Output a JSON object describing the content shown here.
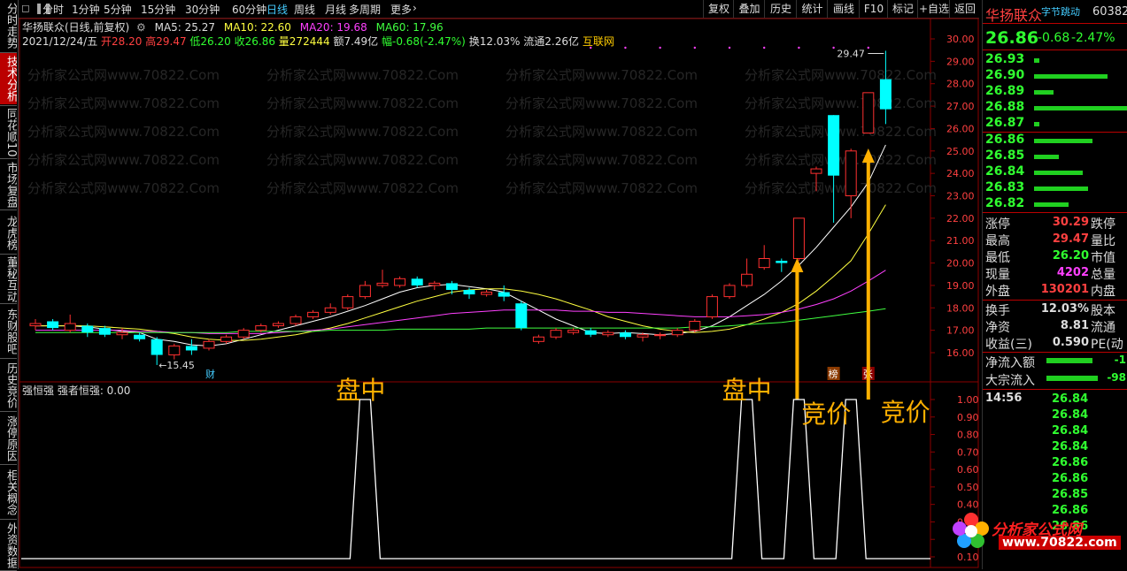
{
  "left_tabs": [
    "分时走势",
    "技术分析",
    "同花顺10",
    "市场复盘",
    "龙虎榜",
    "董秘互动",
    "东财股吧",
    "历史竞价",
    "涨停原因",
    "相关概念",
    "外资数据"
  ],
  "toolbar": {
    "periods": [
      "分时",
      "1分钟",
      "5分钟",
      "15分钟",
      "30分钟",
      "60分钟",
      "日线",
      "周线",
      "月线",
      "多周期",
      "更多"
    ],
    "selected_period": "日线",
    "right_buttons": [
      "复权",
      "叠加",
      "历史",
      "统计",
      "画线",
      "F10",
      "标记",
      "+自选",
      "返回"
    ]
  },
  "main_info": {
    "title": "华扬联众(日线,前复权)",
    "ma5": "MA5: 25.27",
    "ma10": "MA10: 22.60",
    "ma20": "MA20: 19.68",
    "ma60": "MA60: 17.96",
    "date": "2021/12/24/五",
    "open": "开28.20",
    "high": "高29.47",
    "low": "低26.20",
    "close": "收26.86",
    "volume": "量272444",
    "amount": "额7.49亿",
    "change": "幅-0.68(-2.47%)",
    "turnover": "换12.03%",
    "float_cap": "流通2.26亿",
    "source": "互联网"
  },
  "watermark": "分析家公式网www.70822.Com",
  "price_axis": [
    "30.00",
    "29.00",
    "28.00",
    "27.00",
    "26.00",
    "25.00",
    "24.00",
    "23.00",
    "22.00",
    "21.00",
    "20.00",
    "19.00",
    "18.00",
    "17.00",
    "16.00"
  ],
  "high_label": "29.47",
  "low_label": "15.45",
  "badges": {
    "cai": "财",
    "bang": "榜",
    "zhang": "张"
  },
  "sub_panel": {
    "title": "强恒强 强者恒强: 0.00",
    "axis": [
      "1.00",
      "0.90",
      "0.80",
      "0.70",
      "0.60",
      "0.50",
      "0.40",
      "0.30",
      "0.20",
      "0.10"
    ]
  },
  "annotations": {
    "pz1": "盘中",
    "pz2": "盘中",
    "jj1": "竞价",
    "jj2": "竞价"
  },
  "right_panel": {
    "name": "华扬联众",
    "tag": "字节跳动",
    "code": "60382",
    "price": "26.86",
    "change": "-0.68",
    "change_pct": "-2.47%",
    "sells": [
      {
        "price": "26.93",
        "vol": 0.05
      },
      {
        "price": "26.90",
        "vol": 0.75
      },
      {
        "price": "26.89",
        "vol": 0.2
      },
      {
        "price": "26.88",
        "vol": 1.0
      },
      {
        "price": "26.87",
        "vol": 0.05
      }
    ],
    "buys": [
      {
        "price": "26.86",
        "vol": 0.6
      },
      {
        "price": "26.85",
        "vol": 0.25
      },
      {
        "price": "26.84",
        "vol": 0.5
      },
      {
        "price": "26.83",
        "vol": 0.55
      },
      {
        "price": "26.82",
        "vol": 0.35
      }
    ],
    "stats": [
      {
        "label": "涨停",
        "value": "30.29",
        "label2": "跌停",
        "color": "#ff4040"
      },
      {
        "label": "最高",
        "value": "29.47",
        "label2": "量比",
        "color": "#ff4040"
      },
      {
        "label": "最低",
        "value": "26.20",
        "label2": "市值",
        "color": "#30ff30"
      },
      {
        "label": "现量",
        "value": "4202",
        "label2": "总量",
        "color": "#ff40ff"
      },
      {
        "label": "外盘",
        "value": "130201",
        "label2": "内盘",
        "color": "#ff4040"
      }
    ],
    "stats2": [
      {
        "label": "换手",
        "value": "12.03%",
        "label2": "股本"
      },
      {
        "label": "净资",
        "value": "8.81",
        "label2": "流通"
      },
      {
        "label": "收益(三)",
        "value": "0.590",
        "label2": "PE(动"
      }
    ],
    "flows": [
      {
        "label": "净流入额",
        "value": "-1"
      },
      {
        "label": "大宗流入",
        "value": "-98"
      }
    ],
    "ticks_time": "14:56",
    "ticks": [
      "26.84",
      "26.84",
      "26.84",
      "26.84",
      "26.86",
      "26.86",
      "26.85",
      "26.86",
      "26.86"
    ],
    "brand_name": "分析家公式网",
    "brand_url": "www.70822.com"
  },
  "chart_data": {
    "type": "candlestick",
    "ylim": [
      15.0,
      30.2
    ],
    "candles": [
      {
        "o": 17.2,
        "c": 17.3,
        "h": 17.5,
        "l": 17.0
      },
      {
        "o": 17.4,
        "c": 17.1,
        "h": 17.5,
        "l": 17.0
      },
      {
        "o": 17.0,
        "c": 17.3,
        "h": 17.7,
        "l": 16.9
      },
      {
        "o": 17.2,
        "c": 16.9,
        "h": 17.3,
        "l": 16.7
      },
      {
        "o": 17.1,
        "c": 16.8,
        "h": 17.2,
        "l": 16.7
      },
      {
        "o": 16.8,
        "c": 16.9,
        "h": 17.1,
        "l": 16.6
      },
      {
        "o": 16.8,
        "c": 16.6,
        "h": 16.9,
        "l": 16.5
      },
      {
        "o": 16.6,
        "c": 15.9,
        "h": 16.7,
        "l": 15.45
      },
      {
        "o": 15.9,
        "c": 16.3,
        "h": 16.4,
        "l": 15.7
      },
      {
        "o": 16.3,
        "c": 16.1,
        "h": 16.6,
        "l": 15.9
      },
      {
        "o": 16.2,
        "c": 16.5,
        "h": 16.6,
        "l": 16.1
      },
      {
        "o": 16.5,
        "c": 16.7,
        "h": 16.8,
        "l": 16.4
      },
      {
        "o": 16.7,
        "c": 17.0,
        "h": 17.1,
        "l": 16.6
      },
      {
        "o": 17.0,
        "c": 17.2,
        "h": 17.3,
        "l": 16.9
      },
      {
        "o": 17.2,
        "c": 17.3,
        "h": 17.4,
        "l": 17.1
      },
      {
        "o": 17.3,
        "c": 17.6,
        "h": 17.7,
        "l": 17.2
      },
      {
        "o": 17.6,
        "c": 17.8,
        "h": 17.9,
        "l": 17.5
      },
      {
        "o": 17.8,
        "c": 18.0,
        "h": 18.2,
        "l": 17.7
      },
      {
        "o": 18.0,
        "c": 18.5,
        "h": 18.6,
        "l": 17.9
      },
      {
        "o": 18.5,
        "c": 19.0,
        "h": 19.2,
        "l": 18.4
      },
      {
        "o": 19.0,
        "c": 19.1,
        "h": 19.7,
        "l": 18.9
      },
      {
        "o": 19.0,
        "c": 19.3,
        "h": 19.4,
        "l": 18.9
      },
      {
        "o": 19.3,
        "c": 19.0,
        "h": 19.4,
        "l": 18.9
      },
      {
        "o": 19.0,
        "c": 19.1,
        "h": 19.2,
        "l": 18.8
      },
      {
        "o": 19.1,
        "c": 18.8,
        "h": 19.2,
        "l": 18.6
      },
      {
        "o": 18.8,
        "c": 18.6,
        "h": 18.9,
        "l": 18.4
      },
      {
        "o": 18.6,
        "c": 18.7,
        "h": 18.8,
        "l": 18.5
      },
      {
        "o": 18.7,
        "c": 18.5,
        "h": 19.0,
        "l": 18.3
      },
      {
        "o": 18.2,
        "c": 17.1,
        "h": 18.3,
        "l": 17.0
      },
      {
        "o": 16.5,
        "c": 16.7,
        "h": 16.8,
        "l": 16.4
      },
      {
        "o": 16.7,
        "c": 17.0,
        "h": 17.1,
        "l": 16.6
      },
      {
        "o": 16.9,
        "c": 17.0,
        "h": 17.1,
        "l": 16.8
      },
      {
        "o": 17.0,
        "c": 16.8,
        "h": 17.1,
        "l": 16.7
      },
      {
        "o": 16.8,
        "c": 16.9,
        "h": 17.0,
        "l": 16.7
      },
      {
        "o": 16.9,
        "c": 16.7,
        "h": 17.0,
        "l": 16.6
      },
      {
        "o": 16.7,
        "c": 16.8,
        "h": 16.9,
        "l": 16.5
      },
      {
        "o": 16.8,
        "c": 16.8,
        "h": 16.9,
        "l": 16.6
      },
      {
        "o": 16.8,
        "c": 17.0,
        "h": 17.1,
        "l": 16.7
      },
      {
        "o": 17.0,
        "c": 17.4,
        "h": 17.5,
        "l": 16.9
      },
      {
        "o": 17.6,
        "c": 18.5,
        "h": 18.6,
        "l": 17.5
      },
      {
        "o": 18.5,
        "c": 19.0,
        "h": 19.1,
        "l": 18.4
      },
      {
        "o": 19.0,
        "c": 19.5,
        "h": 20.2,
        "l": 18.9
      },
      {
        "o": 19.8,
        "c": 20.2,
        "h": 20.8,
        "l": 19.7
      },
      {
        "o": 20.1,
        "c": 20.0,
        "h": 20.2,
        "l": 19.6
      },
      {
        "o": 20.2,
        "c": 22.0,
        "h": 22.0,
        "l": 20.1
      },
      {
        "o": 24.0,
        "c": 24.2,
        "h": 24.3,
        "l": 23.2
      },
      {
        "o": 26.6,
        "c": 23.9,
        "h": 26.6,
        "l": 21.8
      },
      {
        "o": 23.0,
        "c": 25.0,
        "h": 25.1,
        "l": 22.0
      },
      {
        "o": 25.8,
        "c": 27.6,
        "h": 27.6,
        "l": 25.8
      },
      {
        "o": 28.2,
        "c": 26.86,
        "h": 29.47,
        "l": 26.2
      }
    ],
    "ma_series": [
      {
        "name": "MA5",
        "color": "#ffffff",
        "values": [
          17.2,
          17.2,
          17.2,
          17.15,
          17.05,
          16.95,
          16.9,
          16.6,
          16.5,
          16.35,
          16.3,
          16.4,
          16.6,
          16.8,
          17.0,
          17.2,
          17.4,
          17.6,
          17.85,
          18.1,
          18.4,
          18.7,
          18.9,
          19.0,
          19.05,
          18.95,
          18.85,
          18.7,
          18.3,
          17.9,
          17.5,
          17.2,
          16.9,
          16.85,
          16.9,
          16.85,
          16.8,
          16.85,
          16.95,
          17.2,
          17.6,
          18.1,
          18.6,
          19.2,
          19.9,
          20.7,
          21.6,
          22.5,
          23.6,
          25.27
        ]
      },
      {
        "name": "MA10",
        "color": "#ffff40",
        "values": [
          17.2,
          17.2,
          17.2,
          17.2,
          17.15,
          17.1,
          17.05,
          16.95,
          16.85,
          16.7,
          16.6,
          16.55,
          16.55,
          16.6,
          16.7,
          16.8,
          16.95,
          17.1,
          17.3,
          17.55,
          17.8,
          18.05,
          18.3,
          18.5,
          18.7,
          18.8,
          18.85,
          18.85,
          18.75,
          18.6,
          18.4,
          18.15,
          17.9,
          17.6,
          17.4,
          17.2,
          17.05,
          16.95,
          16.9,
          16.95,
          17.05,
          17.25,
          17.5,
          17.8,
          18.2,
          18.75,
          19.4,
          20.1,
          21.3,
          22.6
        ]
      },
      {
        "name": "MA20",
        "color": "#ff40ff",
        "values": [
          17.0,
          17.0,
          17.0,
          17.0,
          17.0,
          17.0,
          16.95,
          16.95,
          16.9,
          16.9,
          16.85,
          16.85,
          16.85,
          16.85,
          16.9,
          16.95,
          17.0,
          17.05,
          17.15,
          17.25,
          17.35,
          17.45,
          17.55,
          17.65,
          17.75,
          17.8,
          17.85,
          17.9,
          17.9,
          17.9,
          17.9,
          17.85,
          17.85,
          17.8,
          17.8,
          17.75,
          17.7,
          17.65,
          17.6,
          17.6,
          17.6,
          17.65,
          17.7,
          17.8,
          17.95,
          18.15,
          18.4,
          18.75,
          19.2,
          19.68
        ]
      },
      {
        "name": "MA60",
        "color": "#40ff40",
        "values": [
          16.9,
          16.9,
          16.9,
          16.9,
          16.9,
          16.9,
          16.9,
          16.9,
          16.9,
          16.9,
          16.9,
          16.9,
          16.95,
          16.95,
          16.95,
          16.95,
          16.95,
          17.0,
          17.0,
          17.0,
          17.0,
          17.05,
          17.05,
          17.05,
          17.05,
          17.05,
          17.1,
          17.1,
          17.1,
          17.1,
          17.1,
          17.1,
          17.1,
          17.1,
          17.1,
          17.1,
          17.1,
          17.1,
          17.15,
          17.15,
          17.2,
          17.25,
          17.3,
          17.35,
          17.45,
          17.55,
          17.65,
          17.75,
          17.85,
          17.96
        ]
      }
    ],
    "indicator_values": [
      0,
      0,
      0,
      0,
      0,
      0,
      0,
      0,
      0,
      0,
      0,
      0,
      0,
      0,
      0,
      0,
      0,
      0,
      0,
      1,
      0,
      0,
      0,
      0,
      0,
      0,
      0,
      0,
      0,
      0,
      0,
      0,
      0,
      0,
      0,
      0,
      0,
      0,
      0,
      0,
      0,
      1,
      0,
      0,
      1,
      0,
      0,
      1,
      0,
      0
    ],
    "indicator_ylim": [
      0,
      1.05
    ]
  }
}
